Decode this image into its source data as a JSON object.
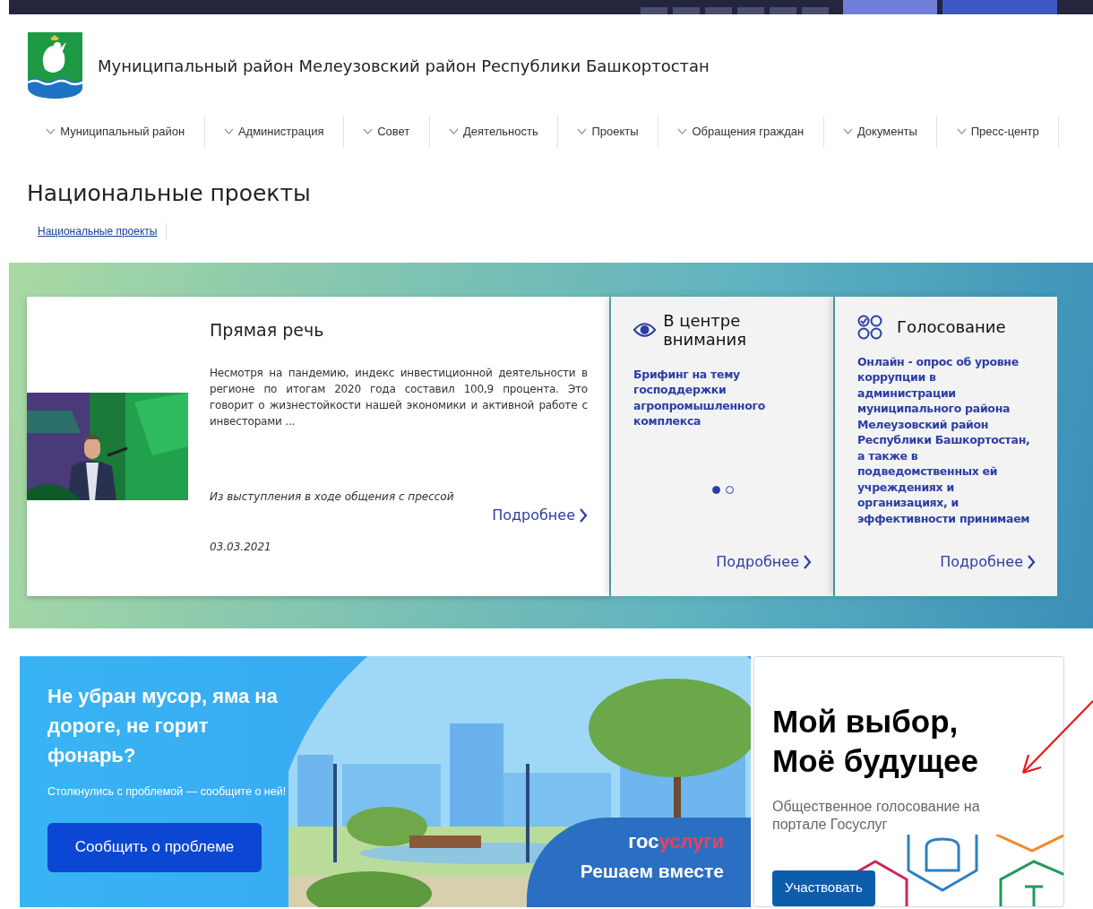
{
  "site": {
    "title": "Муниципальный район Мелеузовский район Республики Башкортостан"
  },
  "nav": [
    {
      "label": "Муниципальный район"
    },
    {
      "label": "Администрация"
    },
    {
      "label": "Совет"
    },
    {
      "label": "Деятельность"
    },
    {
      "label": "Проекты"
    },
    {
      "label": "Обращения граждан"
    },
    {
      "label": "Документы"
    },
    {
      "label": "Пресс-центр"
    }
  ],
  "page_title": "Национальные проекты",
  "breadcrumbs": [
    "Национальные проекты"
  ],
  "feature": {
    "title": "Прямая речь",
    "text": "Несмотря на пандемию, индекс инвестиционной деятельности в регионе по итогам 2020 года составил 100,9 процента. Это говорит о жизнестойкости нашей экономики и активной работе с инвесторами ...",
    "caption": "Из выступления в ходе общения с прессой",
    "more": "Подробнее",
    "date": "03.03.2021"
  },
  "focus": {
    "title": "В центре внимания",
    "link": "Брифинг на тему господдержки агропромышленного комплекса",
    "dots": [
      {
        "selected": true
      },
      {
        "selected": false
      }
    ],
    "more": "Подробнее"
  },
  "voting": {
    "title": "Голосование",
    "link": "Онлайн - опрос об уровне коррупции в администрации муниципального района Мелеузовский район Республики Башкортостан, а также в подведомственных ей учреждениях и организациях, и эффективности принимаем",
    "more": "Подробнее"
  },
  "report_banner": {
    "heading": "Не убран мусор, яма на дороге, не горит фонарь?",
    "subtext": "Столкнулись с проблемой — сообщите о ней!",
    "button": "Сообщить о проблеме",
    "brand_part_1": "гос",
    "brand_part_2": "услуги",
    "slogan": "Решаем вместе"
  },
  "vote_banner": {
    "heading_lines": [
      "Мой выбор,",
      "Моё будущее"
    ],
    "subtext": "Общественное голосование на портале Госуслуг",
    "button": "Участвовать"
  }
}
